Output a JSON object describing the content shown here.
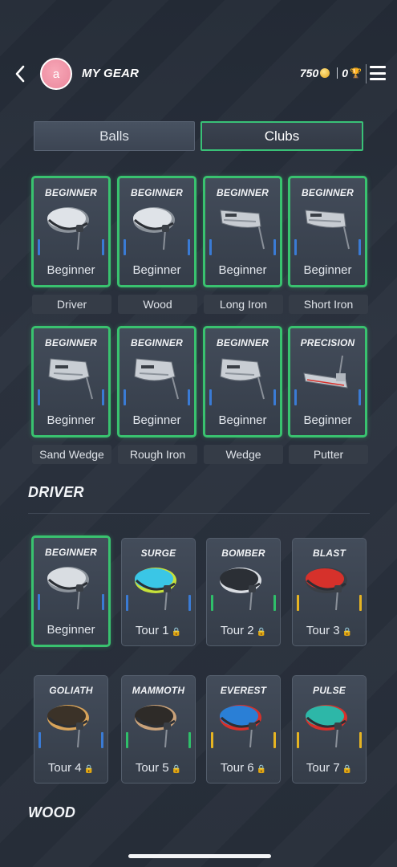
{
  "header": {
    "avatar_letter": "a",
    "title": "MY GEAR",
    "coins": "750",
    "trophies": "0"
  },
  "tabs": [
    {
      "label": "Balls",
      "active": false
    },
    {
      "label": "Clubs",
      "active": true
    }
  ],
  "equipped": [
    {
      "tier": "BEGINNER",
      "name": "Beginner",
      "slot": "Driver",
      "head": "driver",
      "bar": "#3a7bd5"
    },
    {
      "tier": "BEGINNER",
      "name": "Beginner",
      "slot": "Wood",
      "head": "driver",
      "bar": "#3a7bd5"
    },
    {
      "tier": "BEGINNER",
      "name": "Beginner",
      "slot": "Long Iron",
      "head": "iron",
      "bar": "#3a7bd5"
    },
    {
      "tier": "BEGINNER",
      "name": "Beginner",
      "slot": "Short Iron",
      "head": "iron",
      "bar": "#3a7bd5"
    },
    {
      "tier": "BEGINNER",
      "name": "Beginner",
      "slot": "Sand Wedge",
      "head": "wedge",
      "bar": "#3a7bd5"
    },
    {
      "tier": "BEGINNER",
      "name": "Beginner",
      "slot": "Rough Iron",
      "head": "wedge",
      "bar": "#3a7bd5"
    },
    {
      "tier": "BEGINNER",
      "name": "Beginner",
      "slot": "Wedge",
      "head": "wedge",
      "bar": "#3a7bd5"
    },
    {
      "tier": "PRECISION",
      "name": "Beginner",
      "slot": "Putter",
      "head": "putter",
      "bar": "#3a7bd5"
    }
  ],
  "sections": {
    "driver": "DRIVER",
    "wood": "WOOD"
  },
  "drivers": [
    {
      "tier": "BEGINNER",
      "name": "Beginner",
      "locked": false,
      "selected": true,
      "bar": "#3a7bd5",
      "colors": [
        "#d9dde2",
        "#8d949c"
      ]
    },
    {
      "tier": "SURGE",
      "name": "Tour 1",
      "locked": true,
      "selected": false,
      "bar": "#3a7bd5",
      "colors": [
        "#3ac6e6",
        "#c6e13a"
      ]
    },
    {
      "tier": "BOMBER",
      "name": "Tour 2",
      "locked": true,
      "selected": false,
      "bar": "#2fbf6a",
      "colors": [
        "#2b2f35",
        "#d9dde2"
      ]
    },
    {
      "tier": "BLAST",
      "name": "Tour 3",
      "locked": true,
      "selected": false,
      "bar": "#e6b422",
      "colors": [
        "#d6312b",
        "#3a3f46"
      ]
    },
    {
      "tier": "GOLIATH",
      "name": "Tour 4",
      "locked": true,
      "selected": false,
      "bar": "#3a7bd5",
      "colors": [
        "#3b3228",
        "#d7a35a"
      ]
    },
    {
      "tier": "MAMMOTH",
      "name": "Tour 5",
      "locked": true,
      "selected": false,
      "bar": "#2fbf6a",
      "colors": [
        "#2e2b28",
        "#c9a27a"
      ]
    },
    {
      "tier": "EVEREST",
      "name": "Tour 6",
      "locked": true,
      "selected": false,
      "bar": "#e6b422",
      "colors": [
        "#2a7fd6",
        "#d6312b"
      ]
    },
    {
      "tier": "PULSE",
      "name": "Tour 7",
      "locked": true,
      "selected": false,
      "bar": "#e6b422",
      "colors": [
        "#2db7a8",
        "#d6312b"
      ]
    }
  ],
  "colors": {
    "accent": "#39c26f",
    "background": "#262d38",
    "coin": "#e2a41c"
  }
}
